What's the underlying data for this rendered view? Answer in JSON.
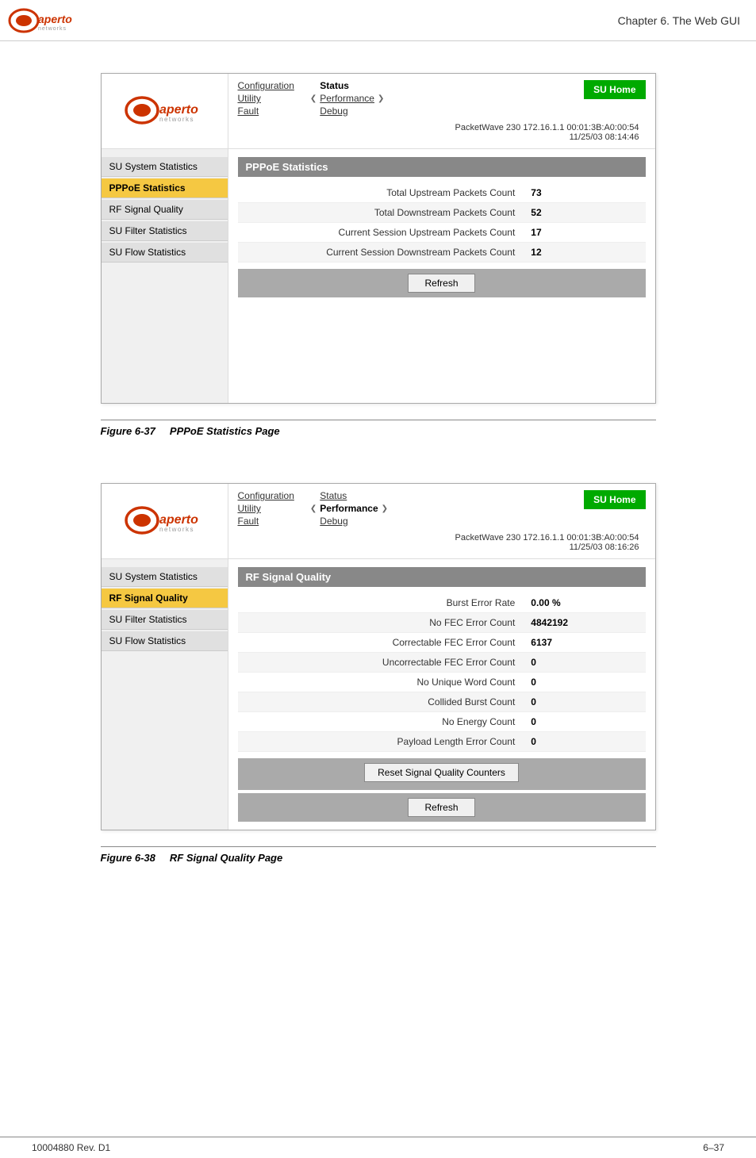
{
  "header": {
    "chapter": "Chapter 6.  The Web GUI"
  },
  "figure1": {
    "label": "Figure 6-37",
    "title": "PPPoE Statistics Page"
  },
  "figure2": {
    "label": "Figure 6-38",
    "title": "RF Signal Quality Page"
  },
  "footer": {
    "left": "10004880 Rev. D1",
    "right": "6–37"
  },
  "screenshot1": {
    "nav": {
      "links1": [
        "Configuration",
        "Utility",
        "Fault"
      ],
      "links2_active": "Status",
      "links2": [
        "Status",
        "Performance",
        "Debug"
      ],
      "su_home": "SU Home",
      "device": "PacketWave 230    172.16.1.1    00:01:3B:A0:00:54",
      "datetime": "11/25/03    08:14:46"
    },
    "sidebar": [
      {
        "label": "SU System Statistics",
        "active": false
      },
      {
        "label": "PPPoE Statistics",
        "active": true
      },
      {
        "label": "RF Signal Quality",
        "active": false
      },
      {
        "label": "SU Filter Statistics",
        "active": false
      },
      {
        "label": "SU Flow Statistics",
        "active": false
      }
    ],
    "content": {
      "title": "PPPoE Statistics",
      "rows": [
        {
          "label": "Total Upstream Packets Count",
          "value": "73"
        },
        {
          "label": "Total Downstream Packets Count",
          "value": "52"
        },
        {
          "label": "Current Session Upstream Packets Count",
          "value": "17"
        },
        {
          "label": "Current Session Downstream Packets Count",
          "value": "12"
        }
      ],
      "refresh_btn": "Refresh"
    }
  },
  "screenshot2": {
    "nav": {
      "links1": [
        "Configuration",
        "Utility",
        "Fault"
      ],
      "links2_active": "Performance",
      "links2": [
        "Status",
        "Performance",
        "Debug"
      ],
      "su_home": "SU Home",
      "device": "PacketWave 230    172.16.1.1    00:01:3B:A0:00:54",
      "datetime": "11/25/03    08:16:26"
    },
    "sidebar": [
      {
        "label": "SU System Statistics",
        "active": false
      },
      {
        "label": "RF Signal Quality",
        "active": true
      },
      {
        "label": "SU Filter Statistics",
        "active": false
      },
      {
        "label": "SU Flow Statistics",
        "active": false
      }
    ],
    "content": {
      "title": "RF Signal Quality",
      "rows": [
        {
          "label": "Burst Error Rate",
          "value": "0.00 %"
        },
        {
          "label": "No FEC Error Count",
          "value": "4842192"
        },
        {
          "label": "Correctable FEC Error Count",
          "value": "6137"
        },
        {
          "label": "Uncorrectable FEC Error Count",
          "value": "0"
        },
        {
          "label": "No Unique Word Count",
          "value": "0"
        },
        {
          "label": "Collided Burst Count",
          "value": "0"
        },
        {
          "label": "No Energy Count",
          "value": "0"
        },
        {
          "label": "Payload Length Error Count",
          "value": "0"
        }
      ],
      "reset_btn": "Reset Signal Quality Counters",
      "refresh_btn": "Refresh"
    }
  }
}
